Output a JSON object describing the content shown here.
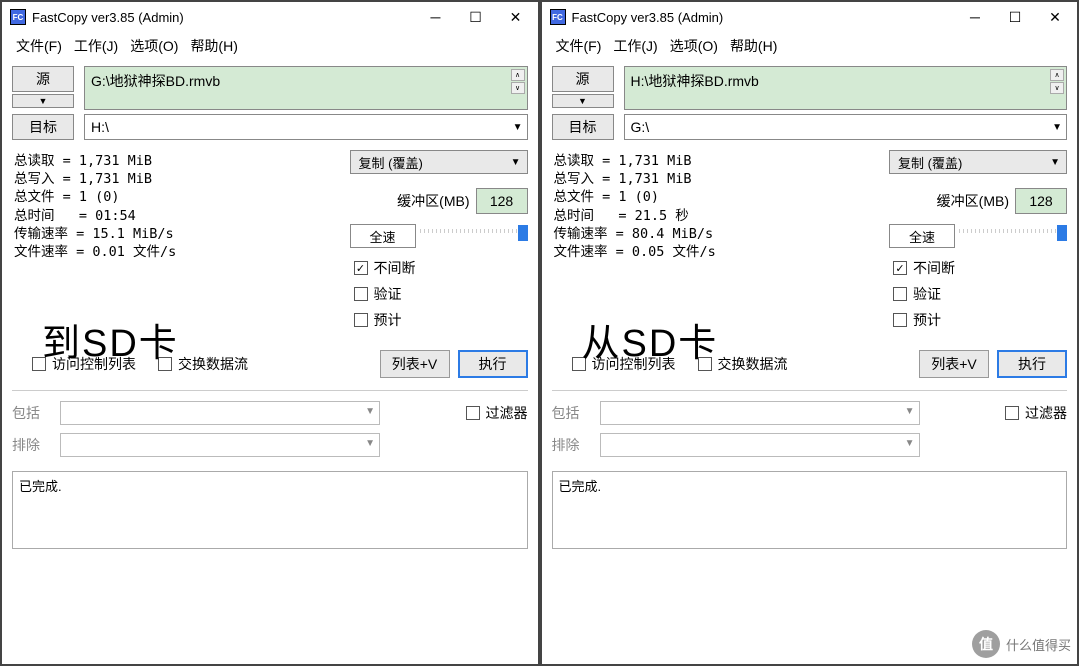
{
  "left": {
    "title": "FastCopy ver3.85 (Admin)",
    "menu": {
      "file": "文件(F)",
      "work": "工作(J)",
      "options": "选项(O)",
      "help": "帮助(H)"
    },
    "source_btn": "源",
    "source_val": "G:\\地狱神探BD.rmvb",
    "dest_btn": "目标",
    "dest_val": "H:\\",
    "stats": "总读取 = 1,731 MiB\n总写入 = 1,731 MiB\n总文件 = 1 (0)\n总时间   = 01:54\n传输速率 = 15.1 MiB/s\n文件速率 = 0.01 文件/s",
    "mode": "复制 (覆盖)",
    "buffer_lbl": "缓冲区(MB)",
    "buffer_val": "128",
    "speed_btn": "全速",
    "check_nonstop": "不间断",
    "check_verify": "验证",
    "check_estimate": "预计",
    "check_acl": "访问控制列表",
    "check_ads": "交换数据流",
    "btn_list": "列表+V",
    "btn_exec": "执行",
    "include_lbl": "包括",
    "exclude_lbl": "排除",
    "filter_chk": "过滤器",
    "status": "已完成.",
    "overlay": "到SD卡"
  },
  "right": {
    "title": "FastCopy ver3.85 (Admin)",
    "menu": {
      "file": "文件(F)",
      "work": "工作(J)",
      "options": "选项(O)",
      "help": "帮助(H)"
    },
    "source_btn": "源",
    "source_val": "H:\\地狱神探BD.rmvb",
    "dest_btn": "目标",
    "dest_val": "G:\\",
    "stats": "总读取 = 1,731 MiB\n总写入 = 1,731 MiB\n总文件 = 1 (0)\n总时间   = 21.5 秒\n传输速率 = 80.4 MiB/s\n文件速率 = 0.05 文件/s",
    "mode": "复制 (覆盖)",
    "buffer_lbl": "缓冲区(MB)",
    "buffer_val": "128",
    "speed_btn": "全速",
    "check_nonstop": "不间断",
    "check_verify": "验证",
    "check_estimate": "预计",
    "check_acl": "访问控制列表",
    "check_ads": "交换数据流",
    "btn_list": "列表+V",
    "btn_exec": "执行",
    "include_lbl": "包括",
    "exclude_lbl": "排除",
    "filter_chk": "过滤器",
    "status": "已完成.",
    "overlay": "从SD卡"
  },
  "watermark": "什么值得买"
}
